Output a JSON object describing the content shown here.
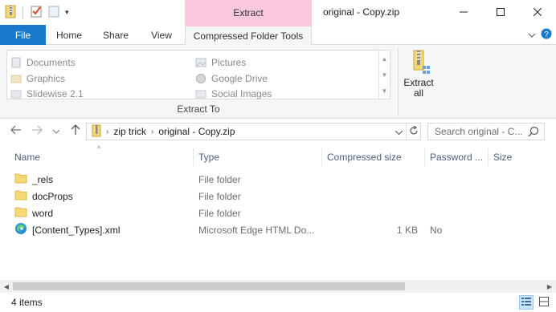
{
  "window": {
    "title": "original - Copy.zip",
    "context_title": "Extract",
    "minimize_icon": "minimize-icon",
    "maximize_icon": "maximize-icon",
    "close_icon": "close-icon"
  },
  "quick_access": {
    "items": [
      "zip-folder-icon",
      "properties-check-icon",
      "new-folder-icon",
      "customize-dropdown-icon"
    ]
  },
  "ribbon_tabs": {
    "file": "File",
    "home": "Home",
    "share": "Share",
    "view": "View",
    "compressed": "Compressed Folder Tools"
  },
  "extract_to": {
    "group_label": "Extract To",
    "destinations": [
      "Documents",
      "Pictures",
      "Graphics",
      "Google Drive",
      "Slidewise 2.1",
      "Social Images"
    ],
    "extract_all_line1": "Extract",
    "extract_all_line2": "all"
  },
  "address": {
    "crumbs": [
      "zip trick",
      "original - Copy.zip"
    ],
    "search_placeholder": "Search original - C..."
  },
  "columns": {
    "name": "Name",
    "type": "Type",
    "compressed_size": "Compressed size",
    "password": "Password ...",
    "size": "Size"
  },
  "files": [
    {
      "name": "_rels",
      "type": "File folder",
      "compressed_size": "",
      "password": "",
      "icon": "folder-icon"
    },
    {
      "name": "docProps",
      "type": "File folder",
      "compressed_size": "",
      "password": "",
      "icon": "folder-icon"
    },
    {
      "name": "word",
      "type": "File folder",
      "compressed_size": "",
      "password": "",
      "icon": "folder-icon"
    },
    {
      "name": "[Content_Types].xml",
      "type": "Microsoft Edge HTML Do...",
      "compressed_size": "1 KB",
      "password": "No",
      "icon": "edge-icon"
    }
  ],
  "status": {
    "item_count": "4 items"
  },
  "colors": {
    "file_tab": "#1979ca",
    "context_tab": "#f8c8dc",
    "header_text": "#4c607a",
    "folder": "#f8d775"
  }
}
